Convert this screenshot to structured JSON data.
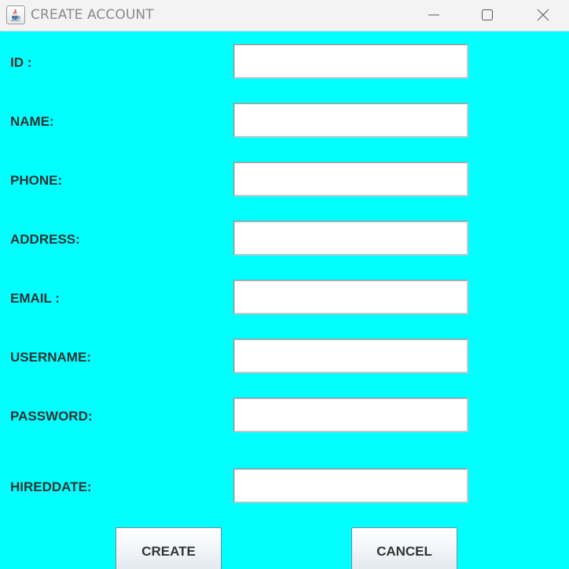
{
  "window": {
    "title": "CREATE ACCOUNT",
    "icon": "java-cup-icon",
    "controls": [
      "minimize-icon",
      "maximize-icon",
      "close-icon"
    ],
    "background_color": "#00ffff"
  },
  "form": {
    "fields": [
      {
        "label": "ID :",
        "value": ""
      },
      {
        "label": "NAME:",
        "value": ""
      },
      {
        "label": "PHONE:",
        "value": ""
      },
      {
        "label": "ADDRESS:",
        "value": ""
      },
      {
        "label": "EMAIL :",
        "value": ""
      },
      {
        "label": "USERNAME:",
        "value": ""
      },
      {
        "label": "PASSWORD:",
        "value": ""
      },
      {
        "label": "HIREDDATE:",
        "value": ""
      }
    ]
  },
  "buttons": {
    "create_label": "CREATE",
    "cancel_label": "CANCEL"
  }
}
